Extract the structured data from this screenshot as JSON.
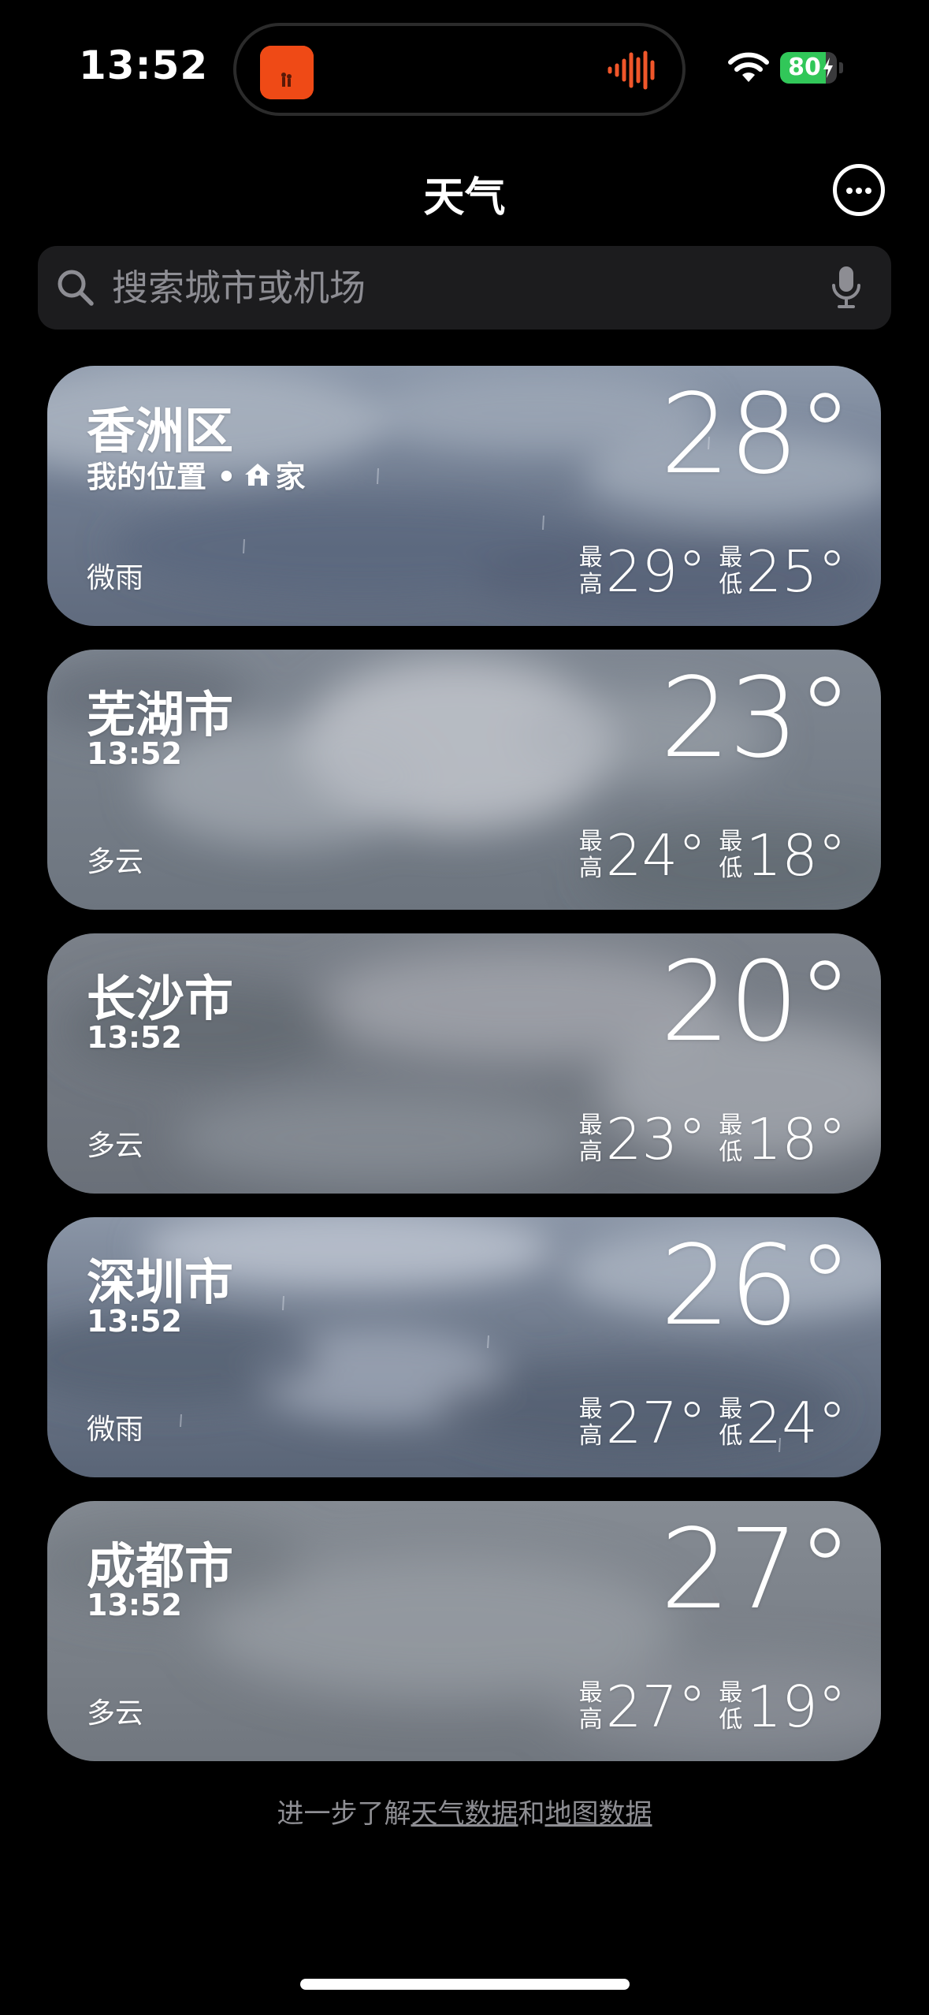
{
  "status_bar": {
    "time": "13:52",
    "battery_percent": "80",
    "battery_level": 0.8,
    "battery_color": "#31c759",
    "live_activity_icon": "music-app-icon",
    "live_activity_indicator": "audio-waveform-icon"
  },
  "nav": {
    "title": "天气",
    "more_icon": "ellipsis-circle-icon"
  },
  "search": {
    "placeholder": "搜索城市或机场",
    "value": "",
    "search_icon": "magnifying-glass-icon",
    "mic_icon": "microphone-icon"
  },
  "cards": [
    {
      "city": "香洲区",
      "subtitle": "我的位置 • ",
      "home_label": "家",
      "condition": "微雨",
      "temp": "28°",
      "high_label_1": "最",
      "high_label_2": "高",
      "high": "29°",
      "low_label_1": "最",
      "low_label_2": "低",
      "low": "25°"
    },
    {
      "city": "芜湖市",
      "subtitle": "13:52",
      "condition": "多云",
      "temp": "23°",
      "high_label_1": "最",
      "high_label_2": "高",
      "high": "24°",
      "low_label_1": "最",
      "low_label_2": "低",
      "low": "18°"
    },
    {
      "city": "长沙市",
      "subtitle": "13:52",
      "condition": "多云",
      "temp": "20°",
      "high_label_1": "最",
      "high_label_2": "高",
      "high": "23°",
      "low_label_1": "最",
      "low_label_2": "低",
      "low": "18°"
    },
    {
      "city": "深圳市",
      "subtitle": "13:52",
      "condition": "微雨",
      "temp": "26°",
      "high_label_1": "最",
      "high_label_2": "高",
      "high": "27°",
      "low_label_1": "最",
      "low_label_2": "低",
      "low": "24°"
    },
    {
      "city": "成都市",
      "subtitle": "13:52",
      "condition": "多云",
      "temp": "27°",
      "high_label_1": "最",
      "high_label_2": "高",
      "high": "27°",
      "low_label_1": "最",
      "low_label_2": "低",
      "low": "19°"
    }
  ],
  "footer": {
    "prefix": "进一步了解",
    "weather_data_link": "天气数据",
    "conjunction": "和",
    "map_data_link": "地图数据"
  }
}
